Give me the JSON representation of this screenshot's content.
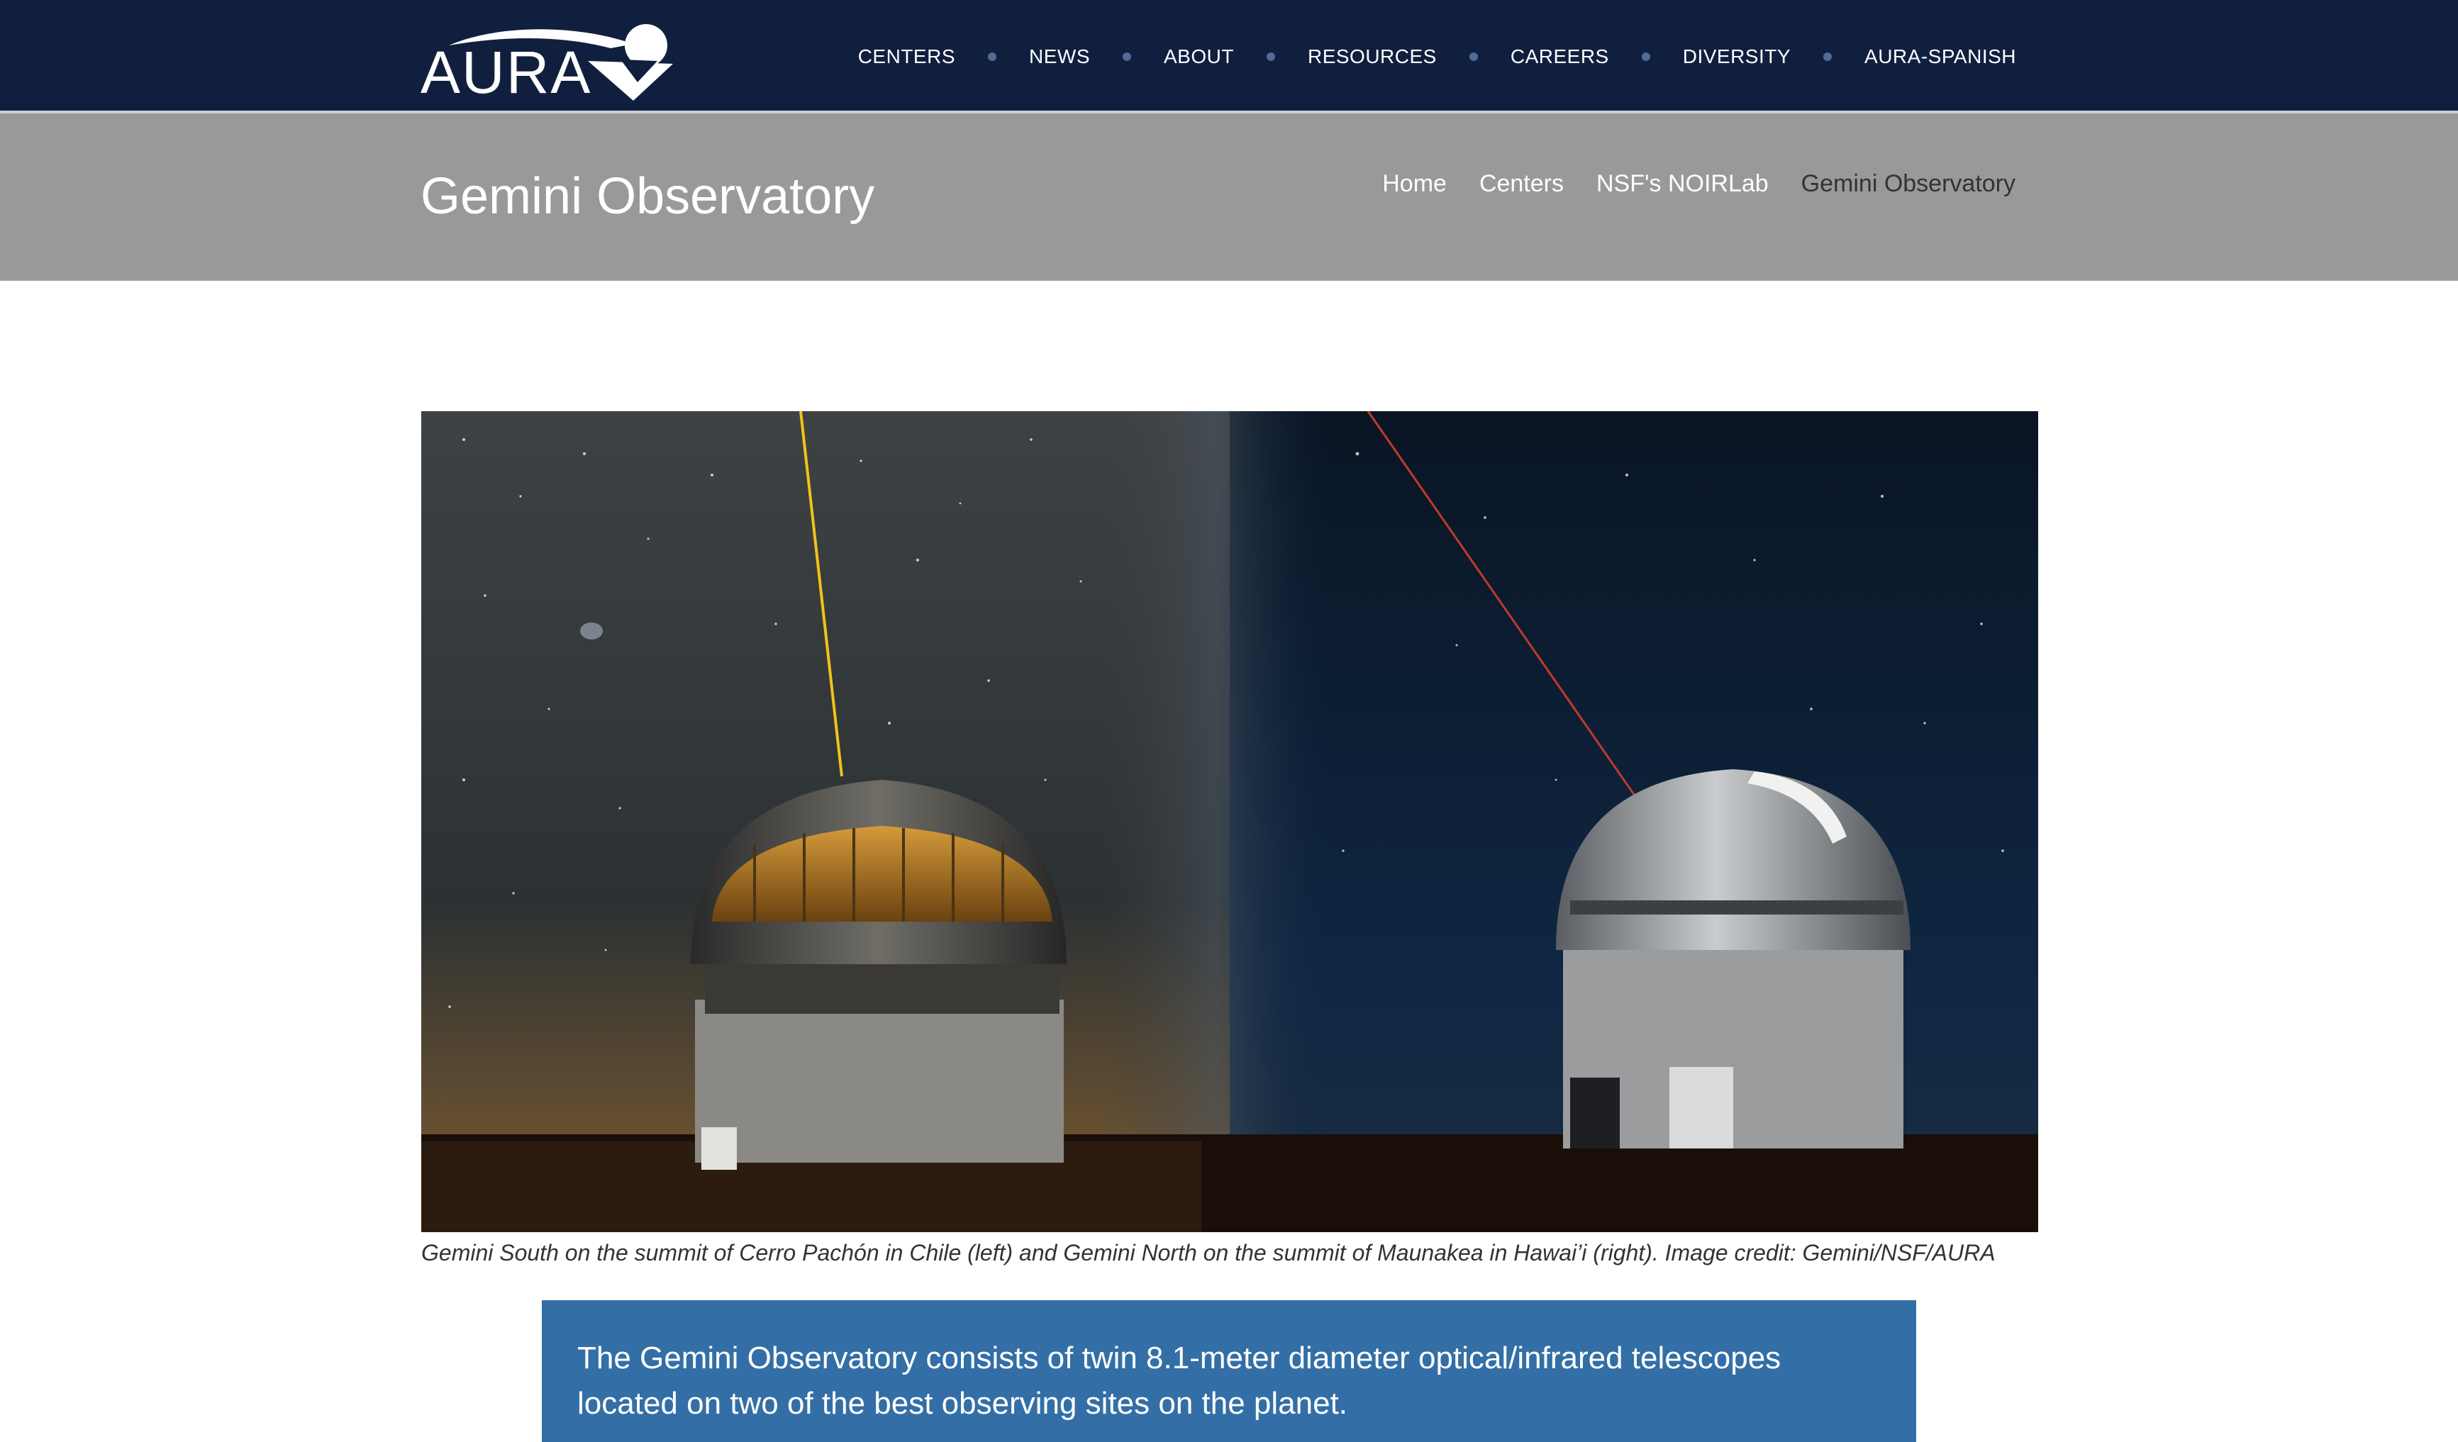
{
  "header": {
    "logo_text": "AURA",
    "nav": [
      {
        "label": "CENTERS"
      },
      {
        "label": "NEWS"
      },
      {
        "label": "ABOUT"
      },
      {
        "label": "RESOURCES"
      },
      {
        "label": "CAREERS"
      },
      {
        "label": "DIVERSITY"
      },
      {
        "label": "AURA-SPANISH"
      }
    ]
  },
  "subheader": {
    "title": "Gemini Observatory",
    "breadcrumb": [
      {
        "label": "Home"
      },
      {
        "label": "Centers"
      },
      {
        "label": "NSF's NOIRLab"
      },
      {
        "label": "Gemini Observatory"
      }
    ]
  },
  "hero": {
    "caption": "Gemini South on the summit of Cerro Pachón in Chile (left) and Gemini North on the summit of Maunakea in Hawai’i (right). Image credit: Gemini/NSF/AURA"
  },
  "intro": {
    "text": "The Gemini Observatory consists of twin 8.1-meter diameter optical/infrared telescopes located on two of the best observing sites on the planet."
  },
  "colors": {
    "topbar": "#111f3f",
    "subbar": "#999999",
    "intro_box": "#336fa6",
    "nav_dot": "#4f6b96"
  }
}
